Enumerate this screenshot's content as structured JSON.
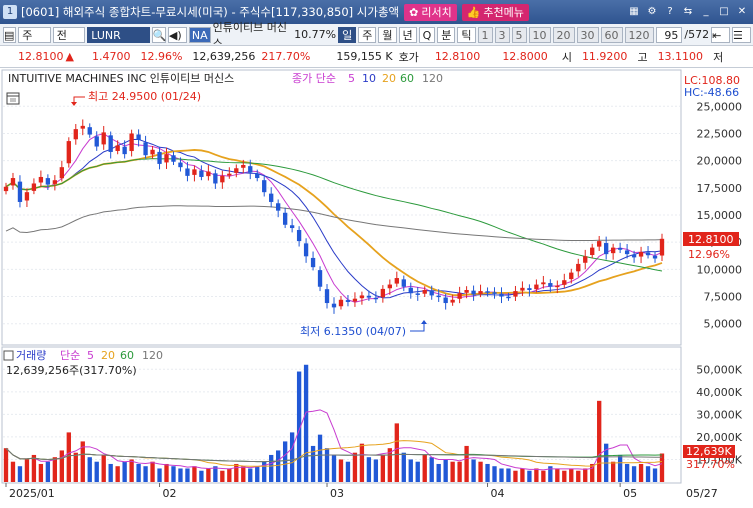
{
  "window": {
    "badge": "1",
    "title": "[0601] 해외주식 종합차트-무료시세(미국) - 주식수[117,330,850] 시가총액",
    "research_btn": "리서치",
    "recommend_btn": "추천메뉴"
  },
  "toolbar": {
    "market": "주",
    "period_sel": "전",
    "symbol": "LUNR",
    "na_badge": "NA",
    "name": "인튜이티브 머신스",
    "pct": "10.77%",
    "intervals": [
      "일",
      "주",
      "월",
      "년",
      "Q",
      "분",
      "틱"
    ],
    "minutes": [
      "1",
      "3",
      "5",
      "10",
      "20",
      "30",
      "60",
      "120"
    ],
    "count": "95",
    "total": "/572"
  },
  "quote": {
    "price": "12.8100",
    "arrow": "▲",
    "change": "1.4700",
    "change_pct": "12.96%",
    "volume": "12,639,256",
    "vol_change_pct": "217.70%",
    "turnover": "159,155 K",
    "bid_label": "호가",
    "bid": "12.8100",
    "ask": "12.8000",
    "open_label": "시",
    "open": "11.9200",
    "high_label": "고",
    "high": "13.1100",
    "low_label": "저"
  },
  "price_panel": {
    "instrument": "INTUITIVE MACHINES INC  인튜이티브 머신스",
    "ma_label": "종가 단순",
    "ma_periods": [
      "5",
      "10",
      "20",
      "60",
      "120"
    ],
    "lc": "LC:108.80",
    "hc": "HC:-48.66",
    "high_note": "최고 24.9500 (01/24)",
    "low_note": "최저 6.1350 (04/07)",
    "last_price_tag": "12.8100",
    "last_pct_tag": "12.96%",
    "y_ticks": [
      "25,0000",
      "22,5000",
      "20,0000",
      "17,5000",
      "15,0000",
      "12,5000",
      "10,0000",
      "7,5000",
      "5,0000"
    ]
  },
  "volume_panel": {
    "label": "거래량",
    "ma_label": "단순",
    "ma_periods": [
      "5",
      "20",
      "60",
      "120"
    ],
    "vol_readout": "12,639,256주(317.70%)",
    "y_ticks": [
      "50,000K",
      "40,000K",
      "30,000K",
      "20,000K",
      "10,000K"
    ],
    "last_vol_tag": "12,639K",
    "last_pct_tag": "317.70%",
    "x_ticks": [
      "2025/01",
      "02",
      "03",
      "04",
      "05",
      "05/27"
    ]
  },
  "chart_data": {
    "type": "candlestick",
    "closes": [
      17.6,
      18.4,
      16.2,
      17.1,
      17.9,
      18.5,
      17.8,
      18.2,
      19.4,
      21.8,
      22.9,
      23.2,
      22.4,
      21.3,
      22.6,
      20.8,
      21.4,
      20.6,
      22.5,
      21.9,
      20.5,
      21.0,
      19.7,
      20.6,
      19.9,
      19.4,
      18.6,
      19.2,
      18.5,
      19.0,
      17.9,
      18.6,
      18.8,
      19.3,
      19.6,
      18.9,
      18.4,
      17.1,
      16.2,
      15.4,
      14.1,
      13.8,
      12.6,
      11.2,
      10.2,
      8.4,
      6.9,
      6.5,
      7.2,
      7.0,
      7.3,
      7.6,
      7.4,
      7.3,
      8.2,
      8.6,
      9.2,
      8.4,
      7.8,
      7.7,
      8.1,
      7.6,
      7.5,
      6.9,
      7.2,
      7.8,
      8.1,
      7.7,
      8.0,
      7.9,
      7.8,
      7.5,
      7.4,
      8.0,
      8.3,
      8.1,
      8.6,
      8.8,
      8.4,
      8.5,
      9.0,
      9.7,
      10.5,
      11.2,
      12.0,
      12.6,
      11.4,
      12.0,
      11.8,
      11.4,
      11.1,
      11.6,
      11.3,
      11.0,
      12.81
    ],
    "volumes_k": [
      15000,
      9000,
      7000,
      10000,
      12000,
      8000,
      9000,
      11000,
      14000,
      22000,
      13000,
      18000,
      11000,
      9000,
      12000,
      8000,
      7000,
      9000,
      10000,
      8000,
      7000,
      9000,
      6000,
      8000,
      7000,
      6000,
      6000,
      7000,
      5000,
      6000,
      7000,
      5000,
      6000,
      8000,
      7000,
      6000,
      7000,
      9000,
      12000,
      14000,
      18000,
      22000,
      49000,
      52000,
      16000,
      21000,
      15000,
      12000,
      10000,
      9000,
      13000,
      17000,
      11000,
      10000,
      12000,
      15000,
      26000,
      13000,
      10000,
      9000,
      12000,
      11000,
      8000,
      10000,
      9000,
      9000,
      16000,
      10000,
      9000,
      8000,
      7000,
      6000,
      6000,
      5000,
      6000,
      5000,
      6000,
      5000,
      7000,
      6000,
      5000,
      6000,
      5000,
      6000,
      8000,
      36000,
      17000,
      9000,
      12000,
      8000,
      7000,
      8000,
      7000,
      6000,
      12639
    ],
    "ylim": [
      3.5,
      26.5
    ],
    "vol_ylim": [
      0,
      55000
    ]
  },
  "colors": {
    "up": "#e1251b",
    "down": "#2158d6",
    "ma5": "#c83cd0",
    "ma10": "#2b3cc8",
    "ma20": "#e6a21e",
    "ma60": "#2c9a3c",
    "ma120": "#777777"
  }
}
